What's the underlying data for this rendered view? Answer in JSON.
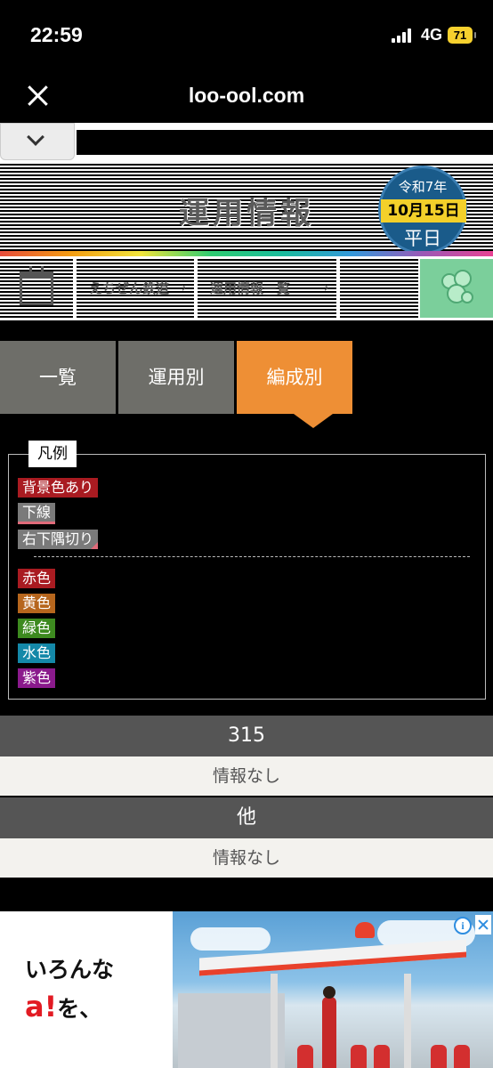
{
  "status_bar": {
    "time": "22:59",
    "network": "4G",
    "battery": "71"
  },
  "browser": {
    "url": "loo-ool.com"
  },
  "banner": {
    "title": "運用情報",
    "date_era": "令和7年",
    "date_day": "10月15日",
    "day_type": "平日"
  },
  "nav": {
    "breadcrumb_1": "えちぜん鉄道",
    "breadcrumb_2": "運用情報一覧"
  },
  "tabs": [
    {
      "label": "一覧"
    },
    {
      "label": "運用別"
    },
    {
      "label": "編成別"
    }
  ],
  "active_tab": "編成別",
  "legend": {
    "title": "凡例",
    "styles": [
      "背景色あり",
      "下線",
      "右下隅切り"
    ],
    "colors": [
      "赤色",
      "黄色",
      "緑色",
      "水色",
      "紫色"
    ]
  },
  "results": [
    {
      "head": "315",
      "info": "情報なし"
    },
    {
      "head": "他",
      "info": "情報なし"
    }
  ],
  "ad": {
    "line1": "いろんな",
    "line2_mark": "a!",
    "line2_text": "を、",
    "info_icon": "i"
  },
  "colors": {
    "accent_orange": "#ee8f35",
    "tab_gray": "#6e6e69",
    "red": "#a91b21",
    "yellow": "#b6661d",
    "green": "#3d8a1f",
    "cyan": "#1488a8",
    "purple": "#8a1a8c"
  },
  "icons": [
    "close-icon",
    "chevron-down-icon",
    "calendar-icon",
    "mascot-icon",
    "info-icon",
    "ad-close-icon",
    "signal-icon",
    "battery-icon"
  ]
}
